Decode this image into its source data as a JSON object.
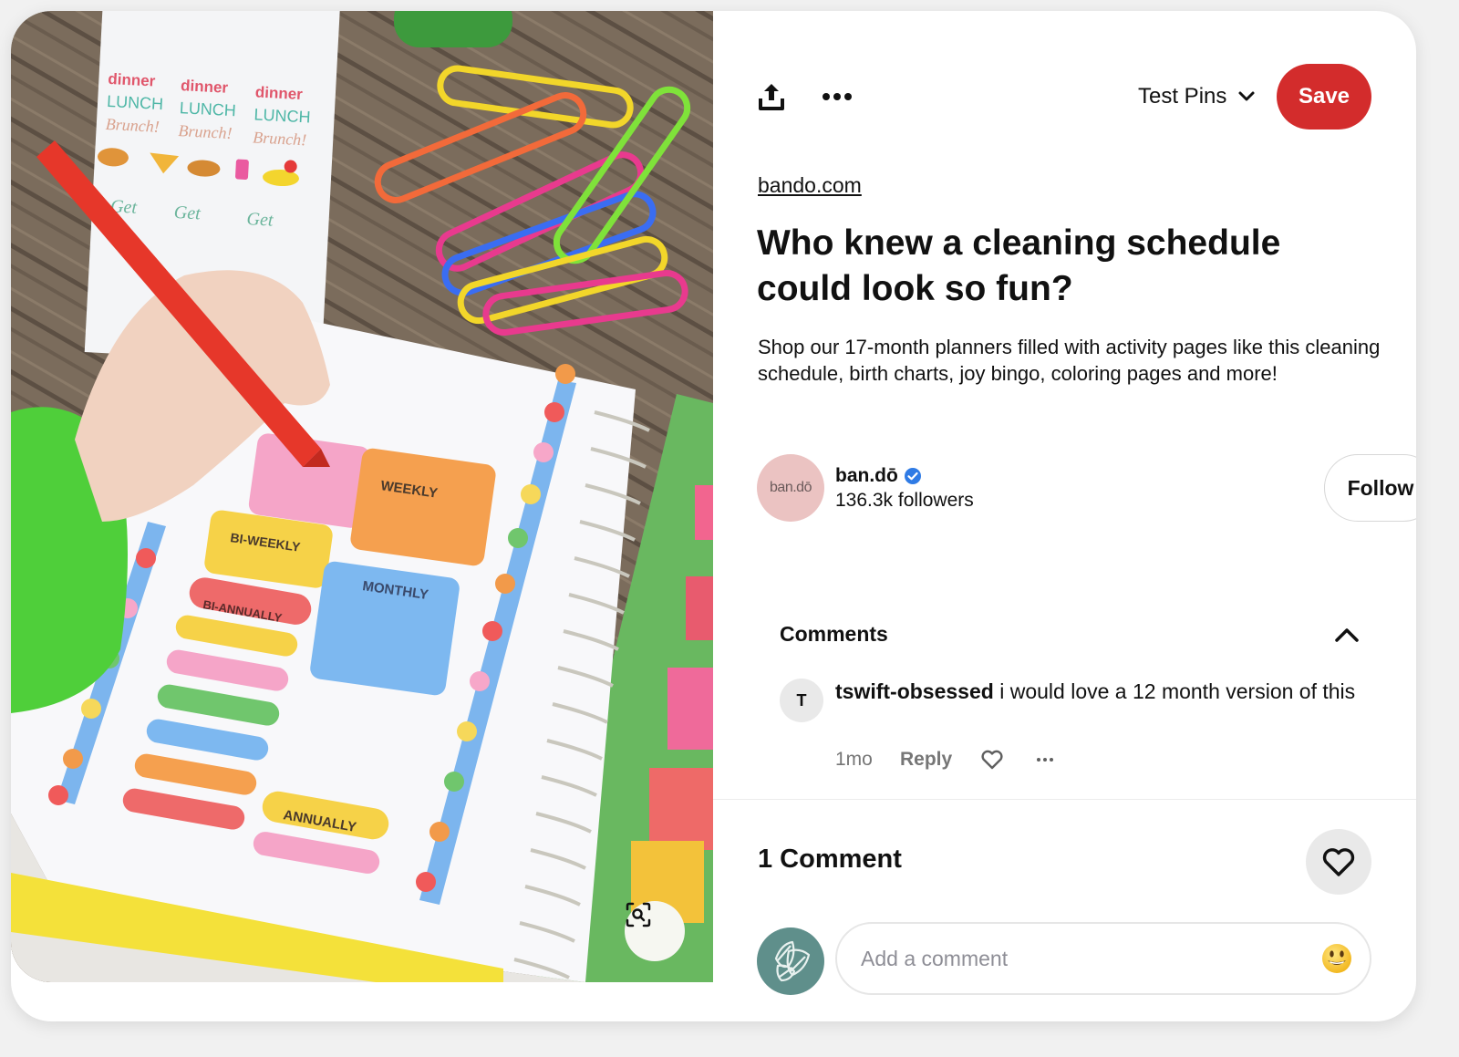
{
  "media": {
    "alt": "Hand writing in a colorful cleaning schedule planner page surrounded by paper clips and sticker sheet",
    "planner_labels": [
      "WEEKLY",
      "BI-WEEKLY",
      "MONTHLY",
      "BI-ANNUALLY",
      "ANNUALLY"
    ],
    "sticker_words": [
      "dinner",
      "LUNCH",
      "Brunch!"
    ],
    "lens_icon": "visual-search-icon"
  },
  "toolbar": {
    "share_icon": "share-upload-icon",
    "more_icon": "more-dots-icon",
    "board_name": "Test Pins",
    "board_chevron": "chevron-down-icon",
    "save_label": "Save",
    "save_color": "#d32c2c"
  },
  "pin": {
    "source": "bando.com",
    "title": "Who knew a cleaning schedule could look so fun?",
    "description": "Shop our 17-month planners filled with activity pages like this cleaning schedule, birth charts, joy bingo, coloring pages and more!"
  },
  "creator": {
    "avatar_text": "ban.dō",
    "name": "ban.dō",
    "verified": true,
    "verified_color": "#2f7be5",
    "followers": "136.3k followers",
    "follow_label": "Follow"
  },
  "comments": {
    "title": "Comments",
    "items": [
      {
        "avatar_letter": "T",
        "user": "tswift-obsessed",
        "text": "i would love a 12 month version of this",
        "time": "1mo",
        "reply_label": "Reply"
      }
    ],
    "count_label": "1 Comment",
    "input_placeholder": "Add a comment"
  }
}
